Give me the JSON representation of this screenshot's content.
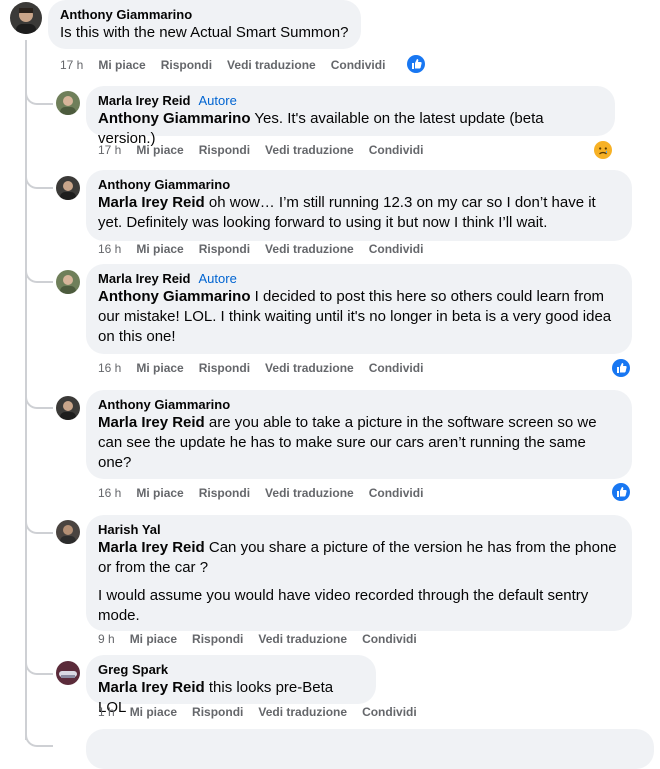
{
  "comments": [
    {
      "author": "Anthony Giammarino",
      "badge": "",
      "mention": "",
      "text": "Is this with the new Actual Smart Summon?",
      "text2": "",
      "time": "17 h",
      "reaction": "like"
    },
    {
      "author": "Marla Irey Reid",
      "badge": "Autore",
      "mention": "Anthony Giammarino",
      "text": " Yes. It's available on the latest update (beta version.)",
      "text2": "",
      "time": "17 h",
      "reaction": "sad"
    },
    {
      "author": "Anthony Giammarino",
      "badge": "",
      "mention": "Marla Irey Reid",
      "text": " oh wow… I’m still running 12.3 on my car so I don’t have it yet. Definitely was looking forward to using it but now I think I’ll wait.",
      "text2": "",
      "time": "16 h",
      "reaction": ""
    },
    {
      "author": "Marla Irey Reid",
      "badge": "Autore",
      "mention": "Anthony Giammarino",
      "text": " I decided to post this here so others could learn from our mistake! LOL. I think waiting until it's no longer in beta is a very good idea on this one!",
      "text2": "",
      "time": "16 h",
      "reaction": "like"
    },
    {
      "author": "Anthony Giammarino",
      "badge": "",
      "mention": "Marla Irey Reid",
      "text": " are you able to take a picture in the software screen so we can see the update he has to make sure our cars aren’t running the same one?",
      "text2": "",
      "time": "16 h",
      "reaction": "like"
    },
    {
      "author": "Harish Yal",
      "badge": "",
      "mention": "Marla Irey Reid",
      "text": " Can you share a picture of the version he has from the phone or from the car ?",
      "text2": "I would assume you would have video recorded through the default sentry mode.",
      "time": "9 h",
      "reaction": ""
    },
    {
      "author": "Greg Spark",
      "badge": "",
      "mention": "Marla Irey Reid",
      "text": " this looks pre-Beta LOL",
      "text2": "",
      "time": "1 h",
      "reaction": ""
    }
  ],
  "actions": {
    "like": "Mi piace",
    "reply": "Rispondi",
    "translate": "Vedi traduzione",
    "share": "Condividi"
  },
  "colors": {
    "like": "#1877f2",
    "sad": "#f7b125",
    "bubble": "#f0f2f5",
    "meta": "#65676b"
  }
}
